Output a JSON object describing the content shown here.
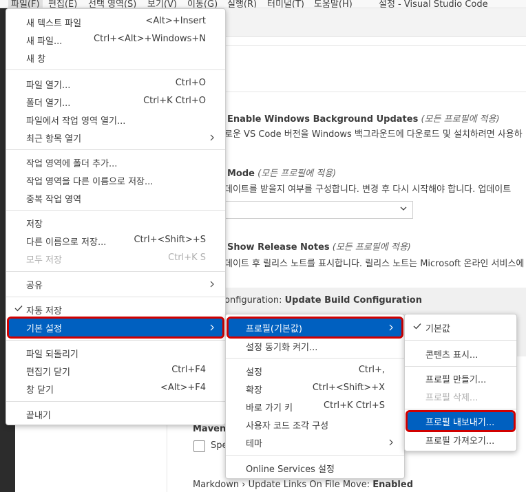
{
  "window": {
    "title": "설정 - Visual Studio Code"
  },
  "menubar": {
    "items": [
      {
        "label": "파일(F)"
      },
      {
        "label": "편집(E)"
      },
      {
        "label": "선택 영역(S)"
      },
      {
        "label": "보기(V)"
      },
      {
        "label": "이동(G)"
      },
      {
        "label": "실행(R)"
      },
      {
        "label": "터미널(T)"
      },
      {
        "label": "도움말(H)"
      }
    ]
  },
  "settings": {
    "bg_updates": {
      "title": "Enable Windows Background Updates",
      "scope": "(모든 프로필에 적용)",
      "desc": "로운 VS Code 버전을 Windows 백그라운드에 다운로드 및 설치하려면 사용하"
    },
    "mode": {
      "title": "Mode",
      "scope": "(모든 프로필에 적용)",
      "desc": "데이트를 받을지 여부를 구성합니다. 변경 후 다시 시작해야 합니다. 업데이트"
    },
    "release_notes": {
      "title": "Show Release Notes",
      "scope": "(모든 프로필에 적용)",
      "desc": "데이트 후 릴리스 노트를 표시합니다. 릴리스 노트는 Microsoft 온라인 서비스에"
    },
    "build_config": {
      "prefix": "onfiguration: ",
      "title": "Update Build Configuration"
    },
    "maven": {
      "title": "Maven ›",
      "desc": "Spe"
    },
    "markdown": {
      "prefix": "Markdown › Update Links On File Move: ",
      "value": "Enabled"
    }
  },
  "file_menu": {
    "groups": [
      [
        {
          "label": "새 텍스트 파일",
          "shortcut": "<Alt>+Insert"
        },
        {
          "label": "새 파일...",
          "shortcut": "Ctrl+<Alt>+Windows+N"
        },
        {
          "label": "새 창",
          "shortcut": ""
        }
      ],
      [
        {
          "label": "파일 열기...",
          "shortcut": "Ctrl+O"
        },
        {
          "label": "폴더 열기...",
          "shortcut": "Ctrl+K Ctrl+O"
        },
        {
          "label": "파일에서 작업 영역 열기...",
          "shortcut": ""
        },
        {
          "label": "최근 항목 열기",
          "shortcut": "",
          "submenu": true
        }
      ],
      [
        {
          "label": "작업 영역에 폴더 추가...",
          "shortcut": ""
        },
        {
          "label": "작업 영역을 다른 이름으로 저장...",
          "shortcut": ""
        },
        {
          "label": "중복 작업 영역",
          "shortcut": ""
        }
      ],
      [
        {
          "label": "저장",
          "shortcut": ""
        },
        {
          "label": "다른 이름으로 저장...",
          "shortcut": "Ctrl+<Shift>+S"
        },
        {
          "label": "모두 저장",
          "shortcut": "Ctrl+K S",
          "disabled": true
        }
      ],
      [
        {
          "label": "공유",
          "shortcut": "",
          "submenu": true
        }
      ],
      [
        {
          "label": "자동 저장",
          "shortcut": "",
          "checked": true
        },
        {
          "label": "기본 설정",
          "shortcut": "",
          "submenu": true,
          "selected": true
        }
      ],
      [
        {
          "label": "파일 되돌리기",
          "shortcut": ""
        },
        {
          "label": "편집기 닫기",
          "shortcut": "Ctrl+F4"
        },
        {
          "label": "창 닫기",
          "shortcut": "<Alt>+F4"
        }
      ],
      [
        {
          "label": "끝내기",
          "shortcut": ""
        }
      ]
    ]
  },
  "prefs_menu": {
    "groups": [
      [
        {
          "label": "프로필(기본값)",
          "shortcut": "",
          "submenu": true,
          "selected": true
        },
        {
          "label": "설정 동기화 켜기...",
          "shortcut": ""
        }
      ],
      [
        {
          "label": "설정",
          "shortcut": "Ctrl+,"
        },
        {
          "label": "확장",
          "shortcut": "Ctrl+<Shift>+X"
        },
        {
          "label": "바로 가기 키",
          "shortcut": "Ctrl+K Ctrl+S"
        },
        {
          "label": "사용자 코드 조각 구성",
          "shortcut": ""
        },
        {
          "label": "테마",
          "shortcut": "",
          "submenu": true
        }
      ],
      [
        {
          "label": "Online Services 설정",
          "shortcut": ""
        }
      ]
    ]
  },
  "profile_menu": {
    "groups": [
      [
        {
          "label": "기본값",
          "checked": true
        }
      ],
      [
        {
          "label": "콘텐츠 표시..."
        }
      ],
      [
        {
          "label": "프로필 만들기..."
        },
        {
          "label": "프로필 삭제...",
          "disabled": true
        }
      ],
      [
        {
          "label": "프로필 내보내기...",
          "selected": true
        },
        {
          "label": "프로필 가져오기..."
        }
      ]
    ]
  },
  "colors": {
    "accent": "#0060c0",
    "highlight_box": "#d10000"
  }
}
